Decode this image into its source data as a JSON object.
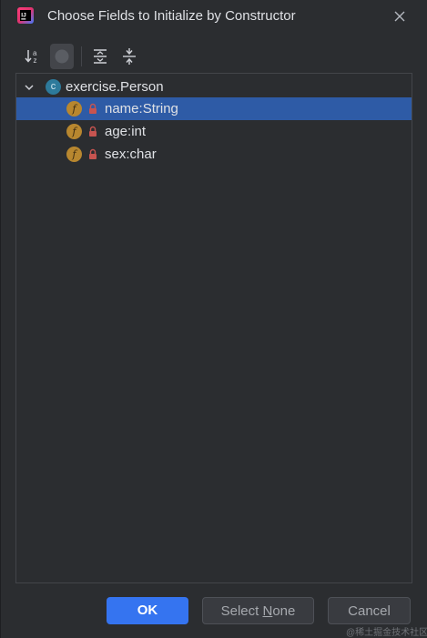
{
  "window": {
    "title": "Choose Fields to Initialize by Constructor",
    "app_icon": "intellij-idea-icon",
    "close_icon": "close-icon"
  },
  "toolbar": {
    "buttons": [
      {
        "name": "sort-alphabetically",
        "icon": "sort-az-icon",
        "selected": false
      },
      {
        "name": "show-classes",
        "icon": "circle-icon",
        "selected": true
      },
      {
        "name": "expand-all",
        "icon": "expand-all-icon",
        "selected": false
      },
      {
        "name": "collapse-all",
        "icon": "collapse-all-icon",
        "selected": false
      }
    ]
  },
  "tree": {
    "root": {
      "label": "exercise.Person",
      "icon_letter": "c",
      "expanded": true
    },
    "fields": [
      {
        "label": "name:String",
        "icon_letter": "f",
        "selected": true
      },
      {
        "label": "age:int",
        "icon_letter": "f",
        "selected": false
      },
      {
        "label": "sex:char",
        "icon_letter": "f",
        "selected": false
      }
    ]
  },
  "buttons": {
    "ok": "OK",
    "select_none_prefix": "Select ",
    "select_none_mnemonic": "N",
    "select_none_suffix": "one",
    "cancel": "Cancel"
  },
  "colors": {
    "background": "#2b2d30",
    "selection": "#2e5ba6",
    "primary_button": "#3574f0",
    "field_icon": "#b8872f",
    "class_icon": "#2d7a9b",
    "lock": "#c75450"
  },
  "watermark": "@稀土掘金技术社区"
}
